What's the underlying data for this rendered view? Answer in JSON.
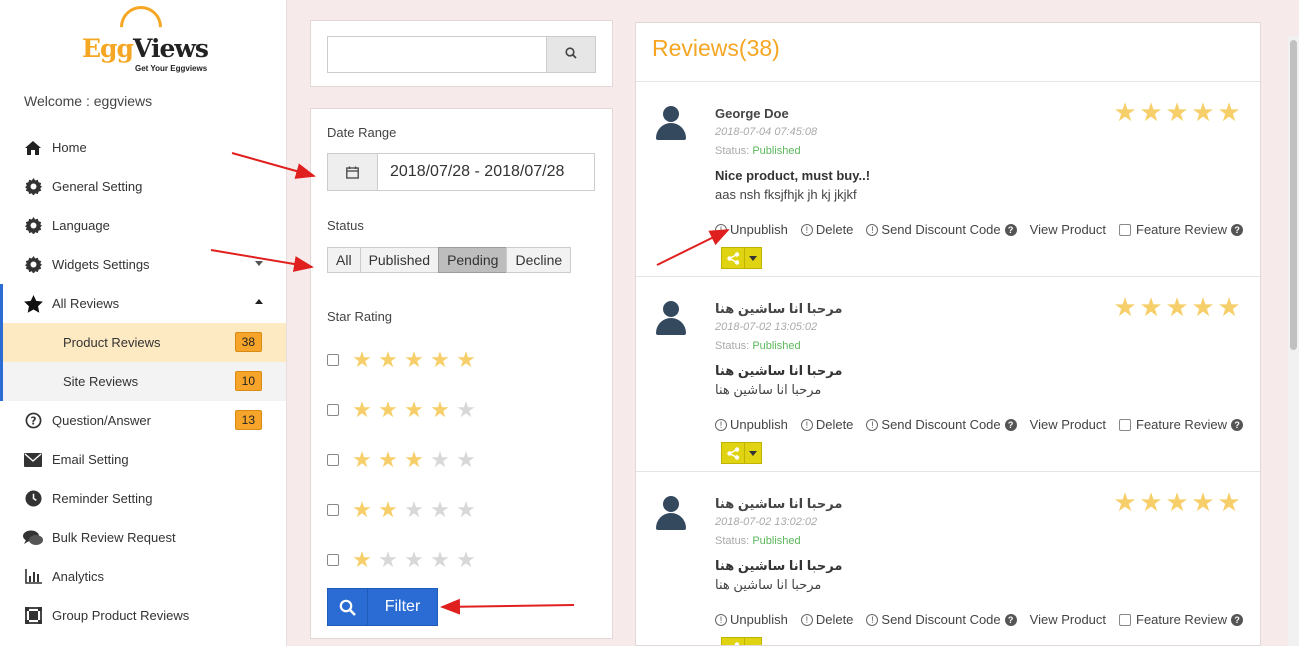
{
  "brand": {
    "logo_egg": "Egg",
    "logo_views": "Views",
    "tagline": "Get Your Eggviews",
    "accent": "#f5a623",
    "primary": "#2b6cd4"
  },
  "sidebar": {
    "welcome": "Welcome : eggviews",
    "items": [
      {
        "label": "Home",
        "icon": "home-icon"
      },
      {
        "label": "General Setting",
        "icon": "gear-icon"
      },
      {
        "label": "Language",
        "icon": "gear-icon"
      },
      {
        "label": "Widgets Settings",
        "icon": "gear-icon"
      },
      {
        "label": "All Reviews",
        "icon": "star-icon"
      },
      {
        "label": "Product Reviews",
        "badge": "38"
      },
      {
        "label": "Site Reviews",
        "badge": "10"
      },
      {
        "label": "Question/Answer",
        "icon": "question-circle-icon",
        "badge": "13"
      },
      {
        "label": "Email Setting",
        "icon": "envelope-icon"
      },
      {
        "label": "Reminder Setting",
        "icon": "clock-icon"
      },
      {
        "label": "Bulk Review Request",
        "icon": "comments-icon"
      },
      {
        "label": "Analytics",
        "icon": "bar-chart-icon"
      },
      {
        "label": "Group Product Reviews",
        "icon": "group-icon"
      }
    ]
  },
  "filters": {
    "search_icon": "search-icon",
    "date_range_label": "Date Range",
    "date_range_value": "2018/07/28 - 2018/07/28",
    "status_label": "Status",
    "status_options": [
      "All",
      "Published",
      "Pending",
      "Decline"
    ],
    "status_selected": "Pending",
    "star_rating_label": "Star Rating",
    "star_options": [
      5,
      4,
      3,
      2,
      1
    ],
    "filter_button": "Filter"
  },
  "reviews": {
    "title": "Reviews(38)",
    "items": [
      {
        "name": "George Doe",
        "date": "2018-07-04 07:45:08",
        "status_label": "Status:",
        "status": "Published",
        "title": "Nice product, must buy..!",
        "body": "aas nsh fksjfhjk jh kj jkjkf",
        "rating": 5
      },
      {
        "name": "مرحبا انا ساشين هنا",
        "date": "2018-07-02 13:05:02",
        "status_label": "Status:",
        "status": "Published",
        "title": "مرحبا انا ساشين هنا",
        "body": "مرحبا انا ساشين هنا",
        "rating": 5
      },
      {
        "name": "مرحبا انا ساشين هنا",
        "date": "2018-07-02 13:02:02",
        "status_label": "Status:",
        "status": "Published",
        "title": "مرحبا انا ساشين هنا",
        "body": "مرحبا انا ساشين هنا",
        "rating": 5
      }
    ],
    "actions": {
      "unpublish": "Unpublish",
      "delete": "Delete",
      "send_discount": "Send Discount Code",
      "view_product": "View Product",
      "feature_review": "Feature Review"
    }
  }
}
